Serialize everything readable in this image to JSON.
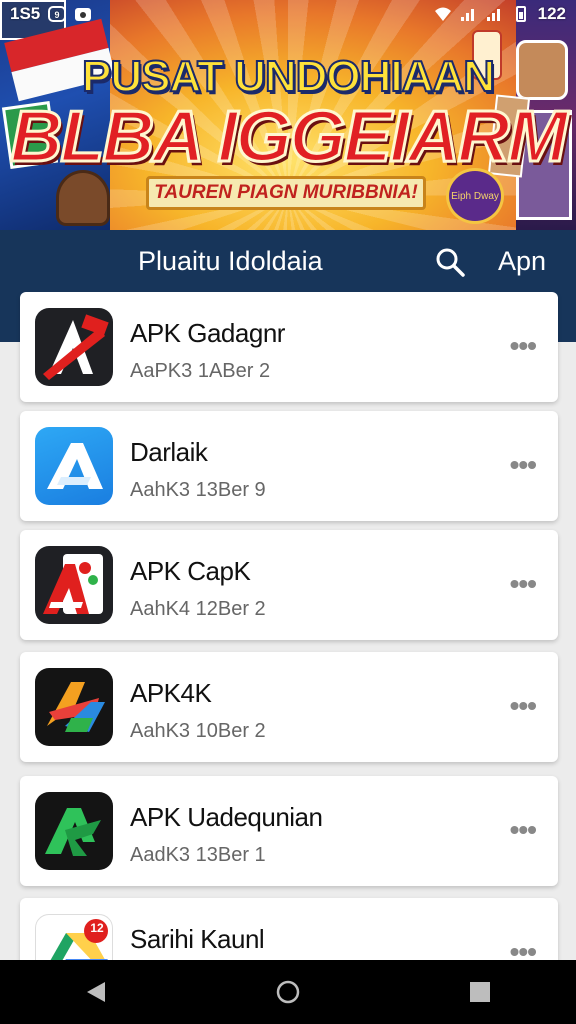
{
  "status_bar": {
    "left_text": "1S5",
    "time": "122"
  },
  "banner": {
    "title": "PUSAT UNDOHIAAN",
    "headline": "BLBA IGGEIARM",
    "ribbon": "TAUREN PIAGN MURIBBNIA!",
    "badge_text": "Eiph Dway"
  },
  "navbar": {
    "title": "Pluaitu Idoldaia",
    "apps_label": "Apn"
  },
  "apps": [
    {
      "name": "APK Gadagnr",
      "sub": "AaPK3 1ABer 2",
      "icon": "apk-red-a-icon"
    },
    {
      "name": "Darlaik",
      "sub": "AahK3 13Ber 9",
      "icon": "blue-a-icon"
    },
    {
      "name": "APK CapK",
      "sub": "AahK4 12Ber 2",
      "icon": "colorful-a-icon"
    },
    {
      "name": "APK4K",
      "sub": "AahK3 10Ber 2",
      "icon": "gradient-a-icon"
    },
    {
      "name": "APK Uadequnian",
      "sub": "AadK3 13Ber 1",
      "icon": "green-a-icon"
    },
    {
      "name": "Sarihi Kaunl",
      "sub": "",
      "icon": "drive-icon",
      "badge": "12"
    }
  ],
  "more_label": "•••"
}
